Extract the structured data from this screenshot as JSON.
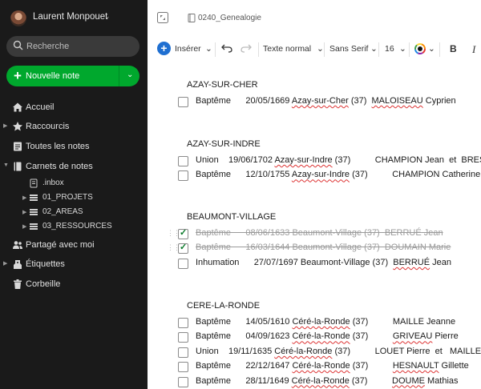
{
  "sidebar": {
    "user_name": "Laurent Monpouet",
    "search_placeholder": "Recherche",
    "new_note_label": "Nouvelle note",
    "nav": [
      {
        "label": "Accueil",
        "icon": "home-icon"
      },
      {
        "label": "Raccourcis",
        "icon": "star-icon"
      },
      {
        "label": "Toutes les notes",
        "icon": "notes-icon"
      },
      {
        "label": "Carnets de notes",
        "icon": "notebook-icon"
      },
      {
        "label": "Partagé avec moi",
        "icon": "people-icon"
      },
      {
        "label": "Étiquettes",
        "icon": "tag-icon"
      },
      {
        "label": "Corbeille",
        "icon": "trash-icon"
      }
    ],
    "notebooks": [
      {
        "label": ".inbox"
      },
      {
        "label": "01_PROJETS"
      },
      {
        "label": "02_AREAS"
      },
      {
        "label": "03_RESSOURCES"
      }
    ]
  },
  "main": {
    "notebook_name": "0240_Genealogie",
    "toolbar": {
      "insert": "Insérer",
      "style": "Texte normal",
      "font": "Sans Serif",
      "size": "16",
      "bold": "B",
      "italic": "I"
    },
    "sections": [
      {
        "heading": "AZAY-SUR-CHER",
        "rows": [
          {
            "done": false,
            "pre": "Baptême      20/05/1669 ",
            "place": "Azay-sur-Cher",
            "mid": " (37)  ",
            "name": "MALOISEAU",
            "post": " Cyprien"
          }
        ]
      },
      {
        "heading": "AZAY-SUR-INDRE",
        "rows": [
          {
            "done": false,
            "pre": "Union    19/06/1702 ",
            "place": "Azay-sur-Indre",
            "mid": " (37)          ",
            "name": "",
            "post": "CHAMPION Jean  et  BRESPEL"
          },
          {
            "done": false,
            "pre": "Baptême      12/10/1755 ",
            "place": "Azay-sur-Indre",
            "mid": " (37)          ",
            "name": "",
            "post": "CHAMPION Catherine"
          }
        ]
      },
      {
        "heading": "BEAUMONT-VILLAGE",
        "rows": [
          {
            "done": true,
            "pre": "Baptême      08/06/1633 Beaumont-Village (37)  ",
            "place": "",
            "mid": "",
            "name": "BERRUÉ",
            "post": " Jean"
          },
          {
            "done": true,
            "pre": "Baptême      16/03/1644 Beaumont-Village (37)  ",
            "place": "",
            "mid": "",
            "name": "DOUMAIN",
            "post": " Marie"
          },
          {
            "done": false,
            "pre": "Inhumation      27/07/1697 Beaumont-Village (37)  ",
            "place": "",
            "mid": "",
            "name": "BERRUÉ",
            "post": " Jean"
          }
        ]
      },
      {
        "heading": "CERE-LA-RONDE",
        "rows": [
          {
            "done": false,
            "pre": "Baptême      14/05/1610 ",
            "place": "Céré-la-Ronde",
            "mid": " (37)          ",
            "name": "",
            "post": "MAILLE Jeanne"
          },
          {
            "done": false,
            "pre": "Baptême      04/09/1623 ",
            "place": "Céré-la-Ronde",
            "mid": " (37)          ",
            "name": "GRIVEAU",
            "post": " Pierre"
          },
          {
            "done": false,
            "pre": "Union    19/11/1635 ",
            "place": "Céré-la-Ronde",
            "mid": " (37)          ",
            "name": "",
            "post": "LOUET Pierre  et   MAILLE Jeanne"
          },
          {
            "done": false,
            "pre": "Baptême      22/12/1647 ",
            "place": "Céré-la-Ronde",
            "mid": " (37)          ",
            "name": "HESNAULT",
            "post": " Gillette"
          },
          {
            "done": false,
            "pre": "Baptême      28/11/1649 ",
            "place": "Céré-la-Ronde",
            "mid": " (37)          ",
            "name": "DOUME",
            "post": " Mathias"
          }
        ]
      }
    ]
  },
  "colors": {
    "accent_green": "#00a82d",
    "accent_blue": "#1f6fd1",
    "sidebar_bg": "#1a1a1a"
  }
}
